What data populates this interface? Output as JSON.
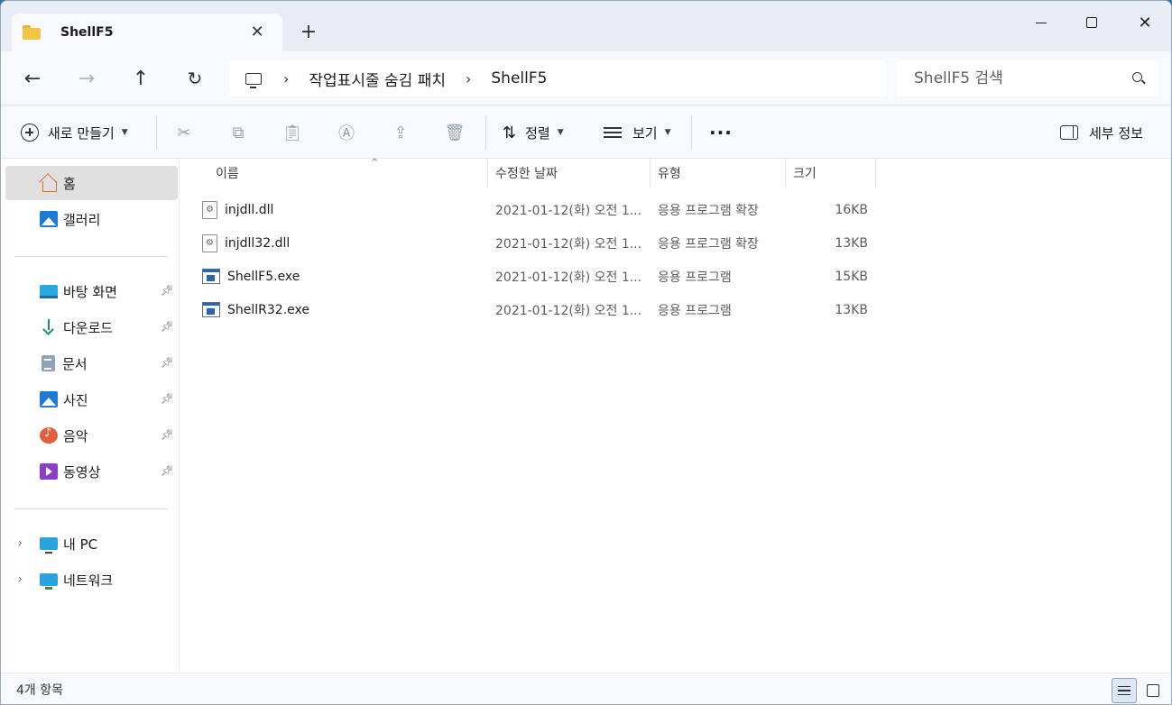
{
  "window": {
    "tab_title": "ShellF5",
    "new_tab_symbol": "+",
    "close_symbol": "✕"
  },
  "address": {
    "breadcrumbs": [
      "작업표시줄 숨김 패치",
      "ShellF5"
    ],
    "separator": "›",
    "search_placeholder": "ShellF5 검색"
  },
  "toolbar": {
    "new_label": "새로 만들기",
    "sort_label": "정렬",
    "view_label": "보기",
    "more_label": "···",
    "details_label": "세부 정보",
    "icons": [
      "cut-icon",
      "copy-icon",
      "paste-icon",
      "rename-icon",
      "share-icon",
      "delete-icon"
    ]
  },
  "sidebar": {
    "items": [
      {
        "label": "홈",
        "icon": "home-icon",
        "selected": true
      },
      {
        "label": "갤러리",
        "icon": "gallery-icon"
      },
      {
        "label": "바탕 화면",
        "icon": "desktop-icon",
        "pinned": true
      },
      {
        "label": "다운로드",
        "icon": "download-icon",
        "pinned": true
      },
      {
        "label": "문서",
        "icon": "documents-icon",
        "pinned": true
      },
      {
        "label": "사진",
        "icon": "pictures-icon",
        "pinned": true
      },
      {
        "label": "음악",
        "icon": "music-icon",
        "pinned": true
      },
      {
        "label": "동영상",
        "icon": "videos-icon",
        "pinned": true
      },
      {
        "label": "내 PC",
        "icon": "pc-icon",
        "expandable": true
      },
      {
        "label": "네트워크",
        "icon": "network-icon",
        "expandable": true
      }
    ]
  },
  "columns": {
    "name": "이름",
    "date": "수정한 날짜",
    "type": "유형",
    "size": "크기"
  },
  "files": [
    {
      "name": "injdll.dll",
      "date": "2021-01-12(화) 오전 1...",
      "type": "응용 프로그램 확장",
      "size": "16KB",
      "icon": "dll-file-icon"
    },
    {
      "name": "injdll32.dll",
      "date": "2021-01-12(화) 오전 1...",
      "type": "응용 프로그램 확장",
      "size": "13KB",
      "icon": "dll-file-icon"
    },
    {
      "name": "ShellF5.exe",
      "date": "2021-01-12(화) 오전 1...",
      "type": "응용 프로그램",
      "size": "15KB",
      "icon": "exe-file-icon"
    },
    {
      "name": "ShellR32.exe",
      "date": "2021-01-12(화) 오전 1...",
      "type": "응용 프로그램",
      "size": "13KB",
      "icon": "exe-file-icon"
    }
  ],
  "status": {
    "item_count": "4개 항목"
  },
  "colors": {
    "accent": "#2c64b3",
    "titlebar": "#e9eef6",
    "selected": "#e0e0e0"
  }
}
